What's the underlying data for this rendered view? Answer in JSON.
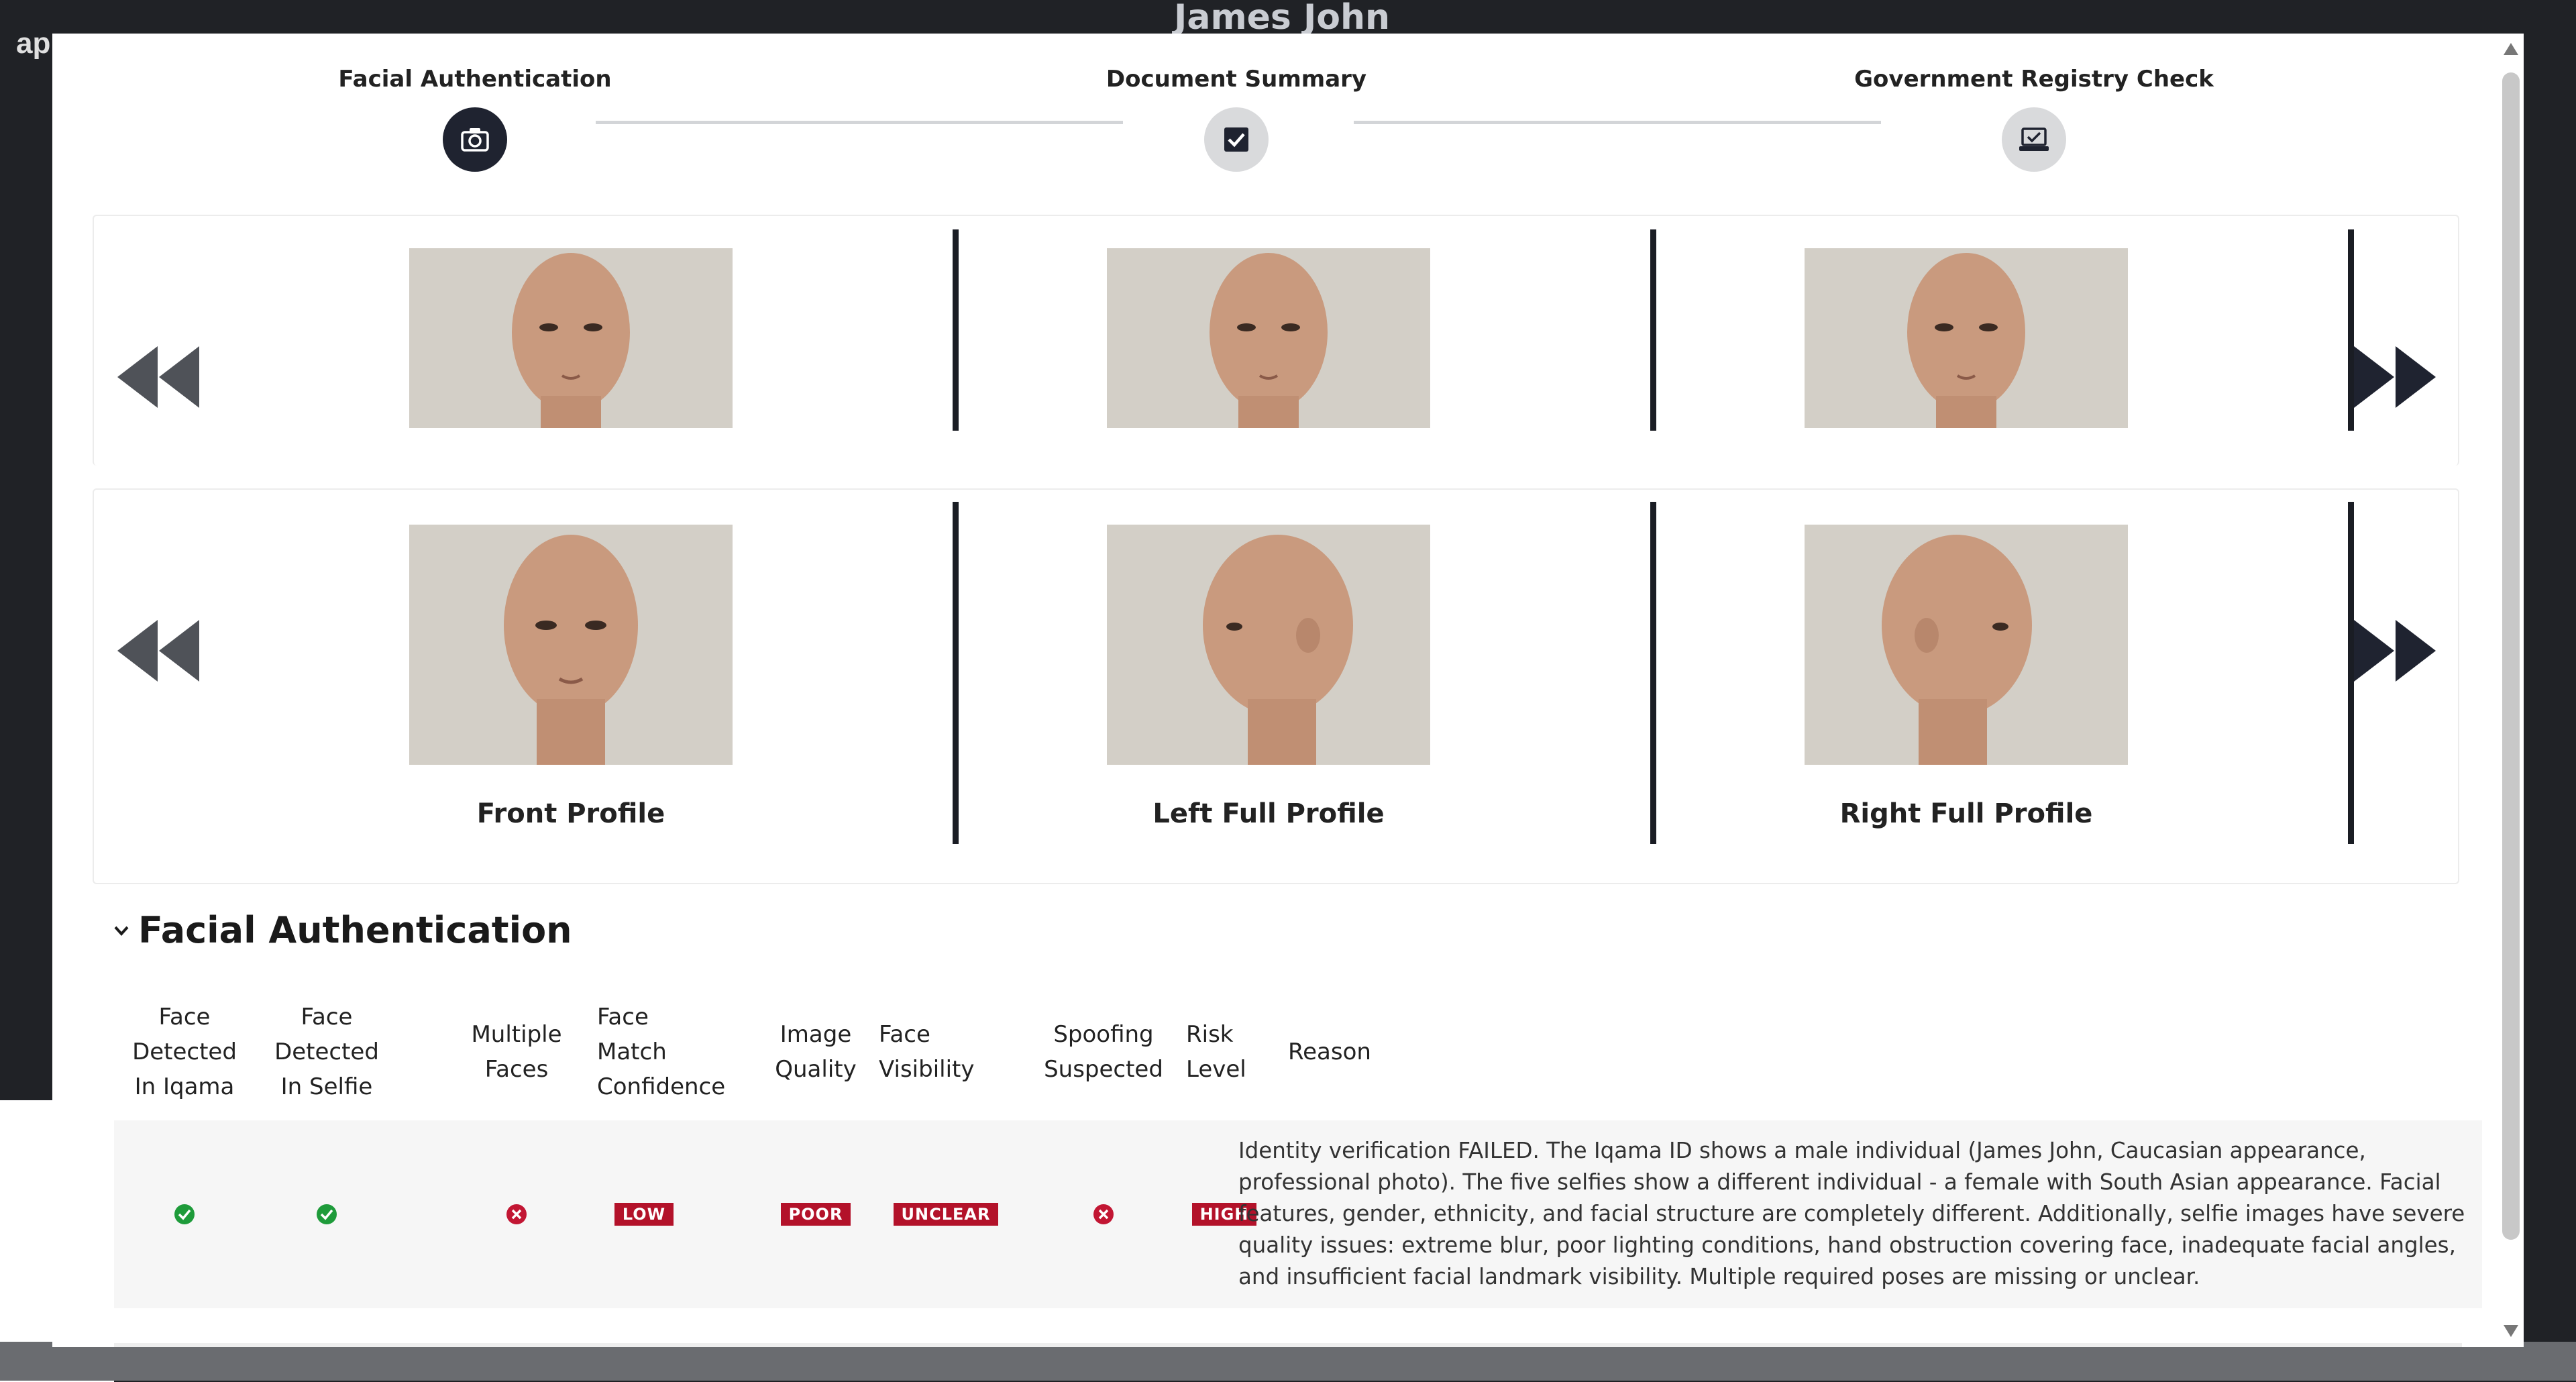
{
  "background": {
    "title": "James John",
    "app_label": "app"
  },
  "stepper": {
    "steps": [
      {
        "label": "Facial Authentication",
        "icon": "camera-icon",
        "state": "active"
      },
      {
        "label": "Document Summary",
        "icon": "checkbox-icon",
        "state": "inactive"
      },
      {
        "label": "Government Registry Check",
        "icon": "laptop-check-icon",
        "state": "inactive"
      }
    ]
  },
  "carousel_top": {
    "photos": [
      {
        "caption": ""
      },
      {
        "caption": ""
      },
      {
        "caption": ""
      }
    ]
  },
  "carousel_bottom": {
    "photos": [
      {
        "caption": "Front Profile"
      },
      {
        "caption": "Left Full Profile"
      },
      {
        "caption": "Right Full Profile"
      }
    ]
  },
  "section": {
    "title": "Facial Authentication"
  },
  "table": {
    "headers": [
      [
        "Face",
        "Detected",
        "In Iqama"
      ],
      [
        "Face",
        "Detected",
        "In Selfie"
      ],
      [
        "Multiple",
        "Faces"
      ],
      [
        "Face",
        "Match",
        "Confidence"
      ],
      [
        "Image",
        "Quality"
      ],
      [
        "Face",
        "Visibility"
      ],
      [
        "Spoofing",
        "Suspected"
      ],
      [
        "Risk",
        "Level"
      ],
      [
        "Reason"
      ]
    ],
    "row": {
      "face_in_iqama": "check",
      "face_in_selfie": "check",
      "multiple_faces": "cross",
      "match_confidence": "LOW",
      "image_quality": "POOR",
      "face_visibility": "UNCLEAR",
      "spoofing": "cross",
      "risk_level": "HIGH",
      "reason": "Identity verification FAILED. The Iqama ID shows a male individual (James John, Caucasian appearance, professional photo). The five selfies show a different individual - a female with South Asian appearance. Facial features, gender, ethnicity, and facial structure are completely different. Additionally, selfie images have severe quality issues: extreme blur, poor lighting conditions, hand obstruction covering face, inadequate facial angles, and insufficient facial landmark visibility. Multiple required poses are missing or unclear."
    }
  },
  "colors": {
    "badge_red": "#b3122a",
    "check_green": "#1e9b3a",
    "cross_red": "#c21633",
    "step_active": "#1f2330"
  }
}
